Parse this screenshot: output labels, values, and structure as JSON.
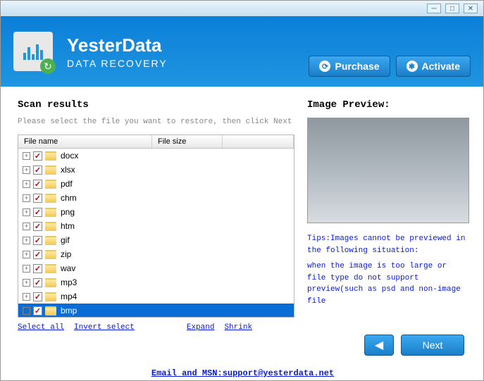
{
  "app": {
    "title": "YesterData",
    "subtitle": "DATA RECOVERY"
  },
  "header_buttons": {
    "purchase": "Purchase",
    "activate": "Activate"
  },
  "scan": {
    "title": "Scan results",
    "instruction": "Please select the file you want to restore, then click Next",
    "columns": {
      "name": "File name",
      "size": "File size"
    },
    "items": [
      {
        "label": "docx",
        "checked": true,
        "selected": false
      },
      {
        "label": "xlsx",
        "checked": true,
        "selected": false
      },
      {
        "label": "pdf",
        "checked": true,
        "selected": false
      },
      {
        "label": "chm",
        "checked": true,
        "selected": false
      },
      {
        "label": "png",
        "checked": true,
        "selected": false
      },
      {
        "label": "htm",
        "checked": true,
        "selected": false
      },
      {
        "label": "gif",
        "checked": true,
        "selected": false
      },
      {
        "label": "zip",
        "checked": true,
        "selected": false
      },
      {
        "label": "wav",
        "checked": true,
        "selected": false
      },
      {
        "label": "mp3",
        "checked": true,
        "selected": false
      },
      {
        "label": "mp4",
        "checked": true,
        "selected": false
      },
      {
        "label": "bmp",
        "checked": true,
        "selected": true
      }
    ],
    "links": {
      "select_all": "Select all",
      "invert": "Invert select",
      "expand": "Expand",
      "shrink": "Shrink"
    }
  },
  "preview": {
    "title": "Image Preview:",
    "tips_label": "Tips:Images cannot be previewed in the following situation:",
    "tips_body": "  when the image is too large or file type do not support preview(such as psd and non-image file"
  },
  "nav": {
    "next": "Next"
  },
  "footer": "Email and MSN:support@yesterdata.net"
}
